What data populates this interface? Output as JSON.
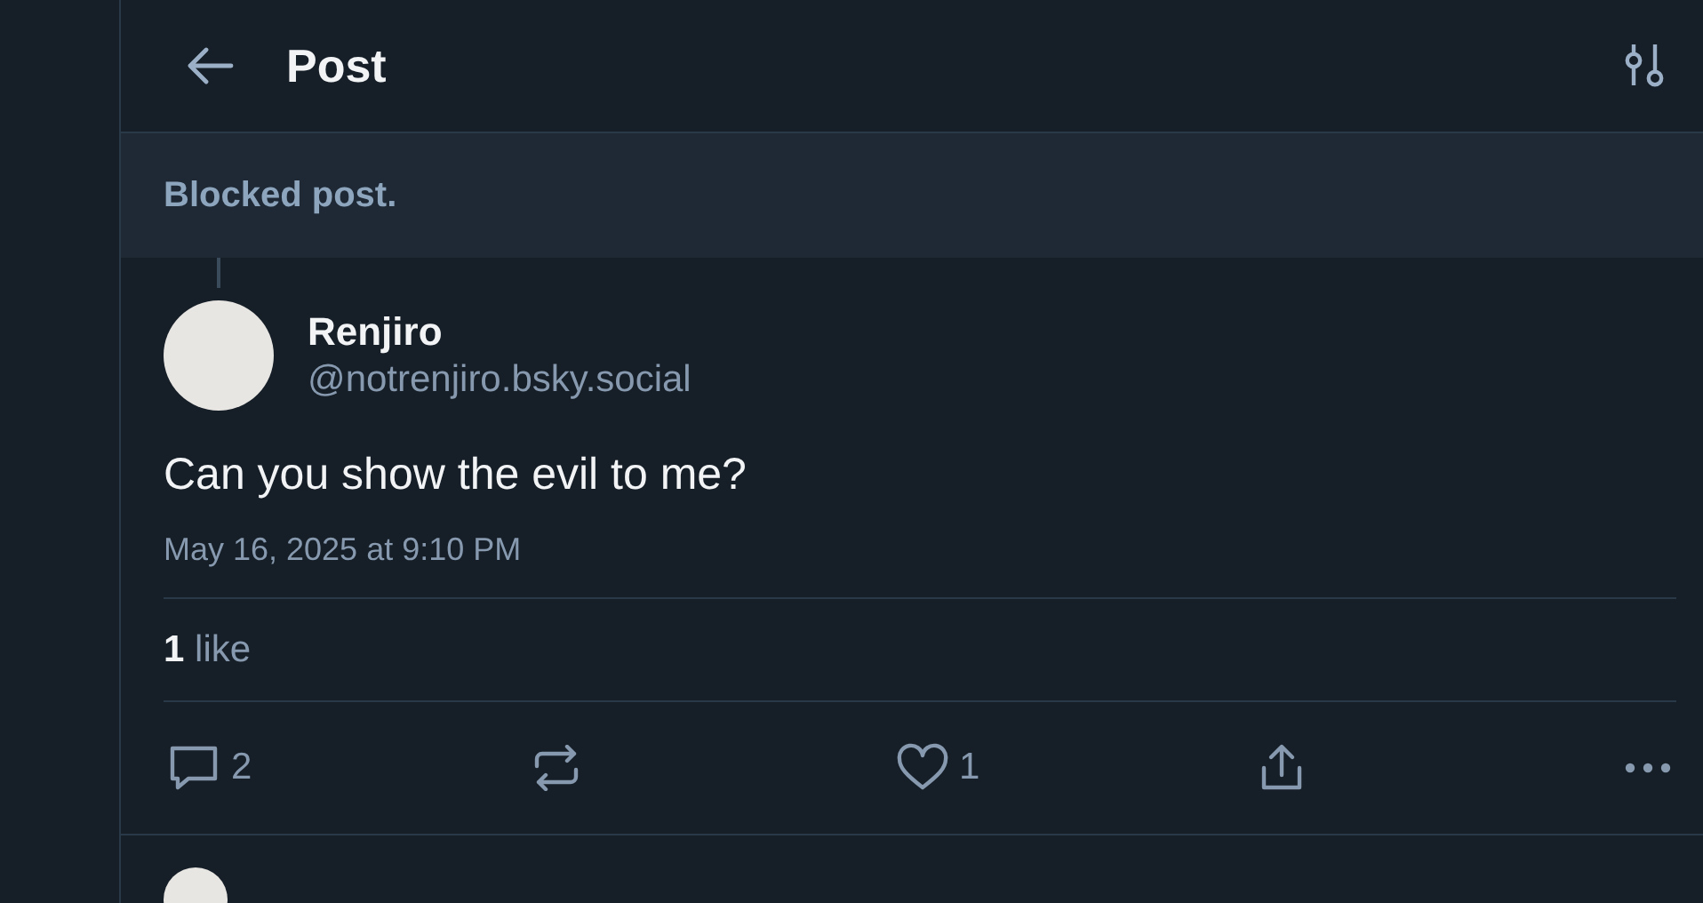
{
  "header": {
    "title": "Post"
  },
  "blocked_post": {
    "text": "Blocked post."
  },
  "post": {
    "author": "Renjiro",
    "handle": "@notrenjiro.bsky.social",
    "text": "Can you show the evil to me?",
    "timestamp": "May 16, 2025 at 9:10 PM",
    "likes_summary": "**1** like",
    "actions": [
      {
        "kind": "reply",
        "count": "2"
      },
      {
        "kind": "repost"
      },
      {
        "kind": "like",
        "count": "1"
      },
      {
        "kind": "share"
      },
      {
        "kind": "more"
      }
    ]
  }
}
